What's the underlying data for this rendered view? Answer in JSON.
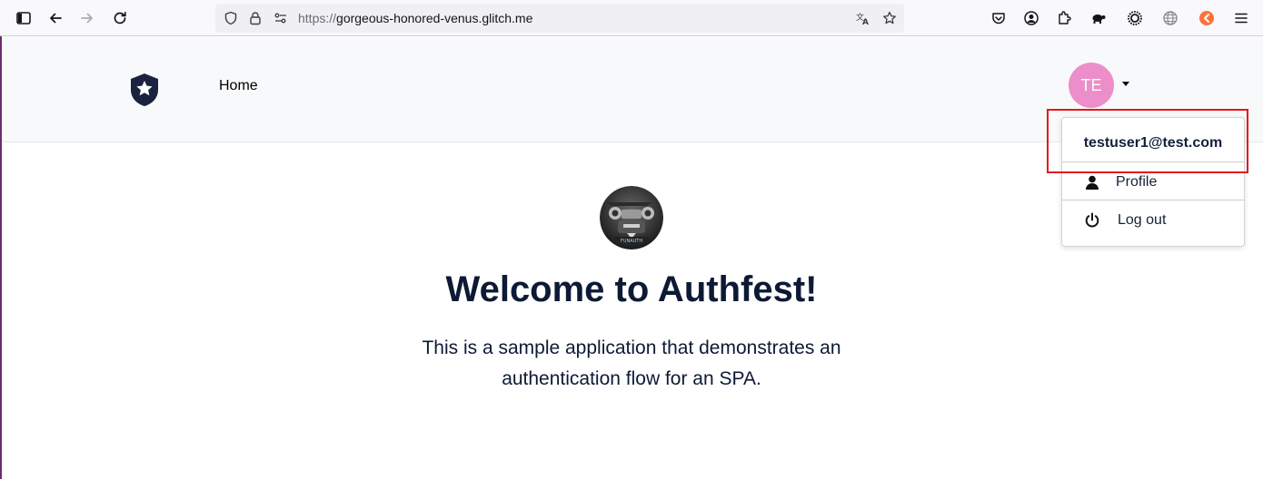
{
  "browser": {
    "url_scheme": "https://",
    "url_host": "gorgeous-honored-venus.glitch.me",
    "toolbar_icons": [
      "sidebar-icon",
      "back-arrow-icon",
      "forward-arrow-icon",
      "reload-icon",
      "shield-icon",
      "lock-icon",
      "permissions-icon",
      "translate-icon",
      "star-icon",
      "pocket-icon",
      "account-icon",
      "extensions-icon",
      "tortoise-icon",
      "sun-icon",
      "globe-icon",
      "orange-extension-icon",
      "menu-icon"
    ]
  },
  "navbar": {
    "home_label": "Home",
    "avatar_initials": "TE",
    "avatar_color": "#ec8ec9"
  },
  "dropdown": {
    "email": "testuser1@test.com",
    "profile_label": "Profile",
    "logout_label": "Log out",
    "highlight_color": "#e4161c"
  },
  "hero": {
    "title": "Welcome to Authfest!",
    "lead": "This is a sample application that demonstrates an authentication flow for an SPA."
  }
}
